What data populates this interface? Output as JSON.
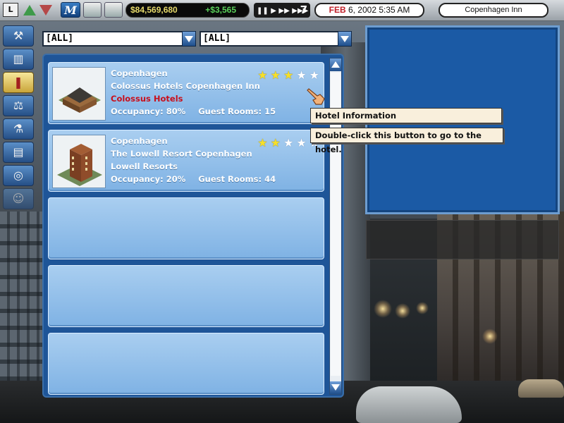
{
  "topbar": {
    "layer_button": "L",
    "money": "$84,569,680",
    "money_delta": "+$3,565",
    "speed_controls": "❚❚ ▶ ▶▶ ▶▶▶",
    "speed_level": "7",
    "date_month": "FEB",
    "date_rest": " 6, 2002 5:35 AM",
    "selected_hotel": "Copenhagen Inn",
    "icons": [
      "up-arrow-icon",
      "down-arrow-icon",
      "m-logo-icon",
      "build-icon",
      "house-icon"
    ]
  },
  "sidebar": {
    "items": [
      {
        "name": "hammer-icon",
        "glyph": "⚒"
      },
      {
        "name": "city-icon",
        "glyph": "▥"
      },
      {
        "name": "book-icon",
        "glyph": "❚"
      },
      {
        "name": "scales-icon",
        "glyph": "⚖"
      },
      {
        "name": "microscope-icon",
        "glyph": "⚗"
      },
      {
        "name": "papers-icon",
        "glyph": "▤"
      },
      {
        "name": "target-icon",
        "glyph": "◎"
      },
      {
        "name": "people-icon",
        "glyph": "☺"
      }
    ],
    "active_index": 2
  },
  "filters": {
    "city": "[ALL]",
    "company": "[ALL]"
  },
  "hotels": [
    {
      "city": "Copenhagen",
      "name": "Colossus Hotels Copenhagen Inn",
      "owner": "Colossus Hotels",
      "occupancy": "Occupancy: 80%",
      "rooms": "Guest Rooms: 15",
      "stars": 3
    },
    {
      "city": "Copenhagen",
      "name": "The Lowell Resort Copenhagen",
      "owner": "Lowell Resorts",
      "occupancy": "Occupancy: 20%",
      "rooms": "Guest Rooms: 44",
      "stars": 2
    }
  ],
  "tooltips": {
    "title": "Hotel Information",
    "body": "Double-click this button to go to the hotel."
  },
  "colors": {
    "panel_blue": "#1e5598",
    "card_blue": "#8fbde9",
    "owner_red": "#c8101c",
    "star_yellow": "#f6df2a"
  }
}
